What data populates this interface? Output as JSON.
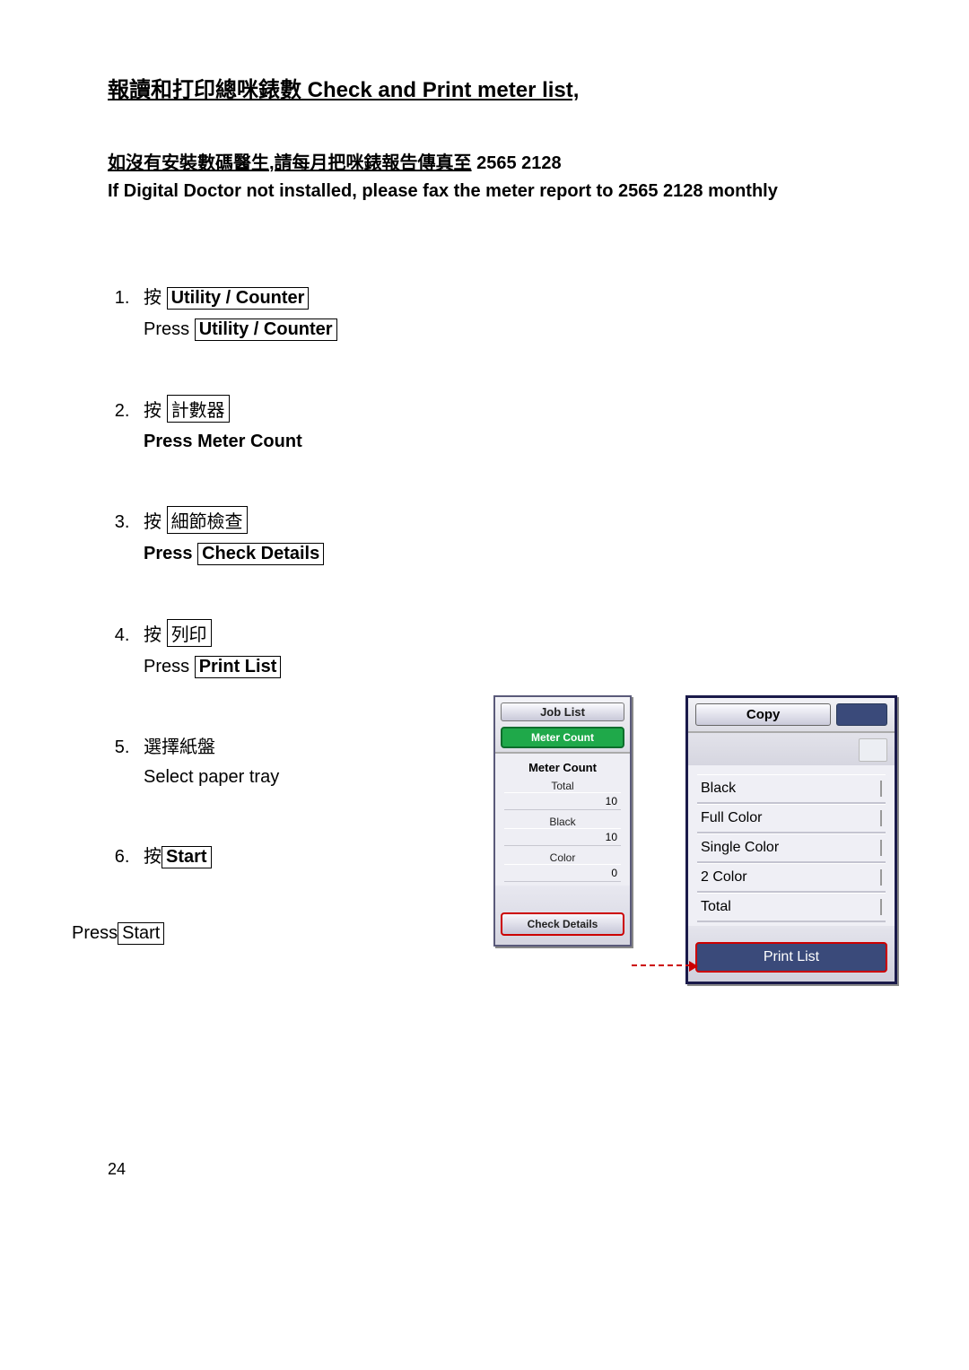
{
  "title": "報讀和打印總咪錶數 Check and Print meter list,",
  "notice_cn": "如沒有安裝數碼醫生,請每月把咪錶報告傳真至",
  "notice_fax": " 2565 2128",
  "notice_en": "If Digital Doctor not installed, please fax the meter report to 2565 2128 monthly",
  "steps": [
    {
      "cn_press": "按 ",
      "cn_btn": "Utility / Counter",
      "en_prefix": "Press ",
      "en_btn": "Utility / Counter"
    },
    {
      "cn_press": "按 ",
      "cn_btn": "計數器",
      "en_prefix": "Press ",
      "en_btn": "Meter Count"
    },
    {
      "cn_press": "按 ",
      "cn_btn": "細節檢查",
      "en_prefix": "Press ",
      "en_btn": "Check Details"
    },
    {
      "cn_press": "按 ",
      "cn_btn": "列印",
      "en_prefix": "Press ",
      "en_btn": "Print List"
    },
    {
      "cn_press": "選擇紙盤",
      "cn_btn": "",
      "en_prefix": "Select paper tray",
      "en_btn": ""
    },
    {
      "cn_press": "按",
      "cn_btn": " Start ",
      "en_prefix": "Press",
      "en_btn": " Start"
    }
  ],
  "left_panel": {
    "job_list": "Job List",
    "meter_count_btn": "Meter Count",
    "section_title": "Meter Count",
    "rows": [
      {
        "label": "Total",
        "value": "10"
      },
      {
        "label": "Black",
        "value": "10"
      },
      {
        "label": "Color",
        "value": "0"
      }
    ],
    "check_details": "Check Details"
  },
  "right_panel": {
    "copy": "Copy",
    "rows": [
      "Black",
      "Full Color",
      "Single Color",
      "2 Color",
      "Total"
    ],
    "print_list": "Print List"
  },
  "page_number": "24"
}
